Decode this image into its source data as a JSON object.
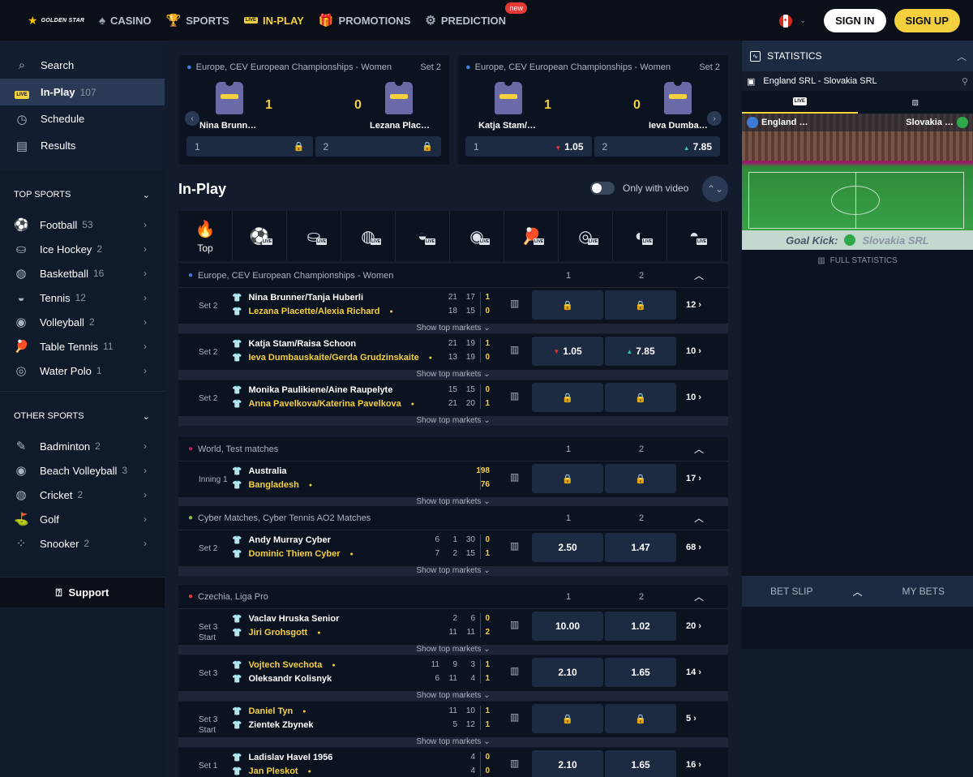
{
  "brand": {
    "name": "GOLDEN STAR"
  },
  "nav": {
    "items": [
      {
        "label": "CASINO",
        "icon": "spade-icon"
      },
      {
        "label": "SPORTS",
        "icon": "trophy-icon"
      },
      {
        "label": "IN-PLAY",
        "icon": "live-tv-icon",
        "badge": "LIVE"
      },
      {
        "label": "PROMOTIONS",
        "icon": "gift-icon"
      },
      {
        "label": "PREDICTION",
        "icon": "gear-question-icon",
        "badge": "new"
      }
    ],
    "signin": "SIGN IN",
    "signup": "SIGN UP"
  },
  "sidebar": {
    "top": [
      {
        "label": "Search",
        "icon": "search-icon"
      },
      {
        "label": "In-Play",
        "count": "107",
        "icon": "live-tv-icon",
        "badge": "LIVE"
      },
      {
        "label": "Schedule",
        "icon": "clock-icon"
      },
      {
        "label": "Results",
        "icon": "clipboard-icon"
      }
    ],
    "top_sports_title": "TOP SPORTS",
    "top_sports": [
      {
        "label": "Football",
        "count": "53"
      },
      {
        "label": "Ice Hockey",
        "count": "2"
      },
      {
        "label": "Basketball",
        "count": "16"
      },
      {
        "label": "Tennis",
        "count": "12"
      },
      {
        "label": "Volleyball",
        "count": "2"
      },
      {
        "label": "Table Tennis",
        "count": "11"
      },
      {
        "label": "Water Polo",
        "count": "1"
      }
    ],
    "other_sports_title": "OTHER SPORTS",
    "other_sports": [
      {
        "label": "Badminton",
        "count": "2"
      },
      {
        "label": "Beach Volleyball",
        "count": "3"
      },
      {
        "label": "Cricket",
        "count": "2"
      },
      {
        "label": "Golf",
        "count": ""
      },
      {
        "label": "Snooker",
        "count": "2"
      }
    ],
    "support": "Support"
  },
  "featured": [
    {
      "league": "Europe, CEV European Championships - Women",
      "set": "Set 2",
      "team1": "Nina Brunn…",
      "team2": "Lezana Plac…",
      "score1": "1",
      "score2": "0",
      "odd1_label": "1",
      "odd2_label": "2",
      "odd1": "",
      "odd2": ""
    },
    {
      "league": "Europe, CEV European Championships - Women",
      "set": "Set 2",
      "team1": "Katja Stam/…",
      "team2": "Ieva Dumba…",
      "score1": "1",
      "score2": "0",
      "odd1_label": "1",
      "odd2_label": "2",
      "odd1": "1.05",
      "odd2": "7.85"
    }
  ],
  "main": {
    "title": "In-Play",
    "only_video": "Only with video",
    "top_tab": "Top",
    "show_top_markets": "Show top markets",
    "col1": "1",
    "col2": "2"
  },
  "leagues": [
    {
      "name": "Europe, CEV European Championships - Women",
      "matches": [
        {
          "set": "Set 2",
          "set2": "",
          "t1": "Nina Brunner/Tanja Huberli",
          "t2": "Lezana Placette/Alexia Richard",
          "serve": 2,
          "s1": [
            "21",
            "17",
            "1"
          ],
          "s2": [
            "18",
            "15",
            "0"
          ],
          "o1": "",
          "o2": "",
          "more": "12"
        },
        {
          "set": "Set 2",
          "set2": "",
          "t1": "Katja Stam/Raisa Schoon",
          "t2": "Ieva Dumbauskaite/Gerda Grudzinskaite",
          "serve": 2,
          "s1": [
            "21",
            "19",
            "1"
          ],
          "s2": [
            "13",
            "19",
            "0"
          ],
          "o1": "1.05",
          "o2": "7.85",
          "more": "10"
        },
        {
          "set": "Set 2",
          "set2": "",
          "t1": "Monika Paulikiene/Aine Raupelyte",
          "t2": "Anna Pavelkova/Katerina Pavelkova",
          "serve": 2,
          "s1": [
            "15",
            "15",
            "0"
          ],
          "s2": [
            "21",
            "20",
            "1"
          ],
          "o1": "",
          "o2": "",
          "more": "10"
        }
      ]
    },
    {
      "name": "World, Test matches",
      "matches": [
        {
          "set": "Inning 1",
          "set2": "",
          "t1": "Australia",
          "t2": "Bangladesh",
          "serve": 2,
          "s1": [
            "",
            "",
            "198"
          ],
          "s2": [
            "",
            "",
            "76"
          ],
          "o1": "",
          "o2": "",
          "more": "17"
        }
      ]
    },
    {
      "name": "Cyber Matches, Cyber Tennis AO2 Matches",
      "matches": [
        {
          "set": "Set 2",
          "set2": "",
          "t1": "Andy Murray Cyber",
          "t2": "Dominic Thiem Cyber",
          "serve": 2,
          "s1": [
            "6",
            "1",
            "30",
            "0"
          ],
          "s2": [
            "7",
            "2",
            "15",
            "1"
          ],
          "o1": "2.50",
          "o2": "1.47",
          "more": "68"
        }
      ]
    },
    {
      "name": "Czechia, Liga Pro",
      "matches": [
        {
          "set": "Set 3",
          "set2": "Start",
          "t1": "Vaclav Hruska Senior",
          "t2": "Jiri Grohsgott",
          "serve": 2,
          "s1": [
            "2",
            "6",
            "0"
          ],
          "s2": [
            "11",
            "11",
            "2"
          ],
          "o1": "10.00",
          "o2": "1.02",
          "more": "20"
        },
        {
          "set": "Set 3",
          "set2": "",
          "t1": "Vojtech Svechota",
          "t2": "Oleksandr Kolisnyk",
          "serve": 1,
          "s1": [
            "11",
            "9",
            "3",
            "1"
          ],
          "s2": [
            "6",
            "11",
            "4",
            "1"
          ],
          "o1": "2.10",
          "o2": "1.65",
          "more": "14"
        },
        {
          "set": "Set 3",
          "set2": "Start",
          "t1": "Daniel Tyn",
          "t2": "Zientek Zbynek",
          "serve": 1,
          "s1": [
            "11",
            "10",
            "1"
          ],
          "s2": [
            "5",
            "12",
            "1"
          ],
          "o1": "",
          "o2": "",
          "more": "5"
        },
        {
          "set": "Set 1",
          "set2": "",
          "t1": "Ladislav Havel 1956",
          "t2": "Jan Pleskot",
          "serve": 2,
          "s1": [
            "4",
            "0"
          ],
          "s2": [
            "4",
            "0"
          ],
          "o1": "2.10",
          "o2": "1.65",
          "more": "16"
        }
      ]
    }
  ],
  "stats": {
    "title": "STATISTICS",
    "match": "England SRL - Slovakia SRL",
    "team1": "England …",
    "team2": "Slovakia …",
    "event_label": "Goal Kick:",
    "event_team": "Slovakia SRL",
    "full_stats": "FULL STATISTICS"
  },
  "betslip": {
    "label": "BET SLIP",
    "my_bets": "MY BETS"
  },
  "colors": {
    "accent": "#f4d03f",
    "bg": "#131c2c",
    "panel": "#0b1220",
    "odd": "#1c2a42"
  }
}
